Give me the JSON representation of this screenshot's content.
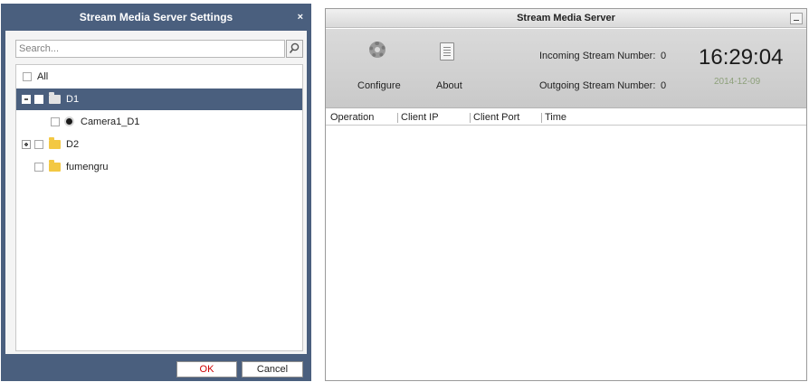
{
  "settings_dialog": {
    "title": "Stream Media Server Settings",
    "close_glyph": "×",
    "search_placeholder": "Search...",
    "tree": [
      {
        "label": "All",
        "level": 0
      },
      {
        "label": "D1",
        "level": 0,
        "selected": true,
        "expanded": true
      },
      {
        "label": "Camera1_D1",
        "level": 1
      },
      {
        "label": "D2",
        "level": 0,
        "expanded": false
      },
      {
        "label": "fumengru",
        "level": 0
      }
    ],
    "ok_label": "OK",
    "cancel_label": "Cancel"
  },
  "server_window": {
    "title": "Stream Media Server",
    "toolbar": {
      "configure_label": "Configure",
      "about_label": "About"
    },
    "stats": {
      "incoming_label": "Incoming Stream Number:",
      "incoming_value": "0",
      "outgoing_label": "Outgoing Stream Number:",
      "outgoing_value": "0"
    },
    "clock": {
      "time": "16:29:04",
      "date": "2014-12-09"
    },
    "table": {
      "columns": [
        "Operation",
        "Client IP",
        "Client Port",
        "Time"
      ]
    }
  },
  "colors": {
    "dialog_frame": "#4a5f7e",
    "ok_text": "#cc0000",
    "date_text": "#8da07a"
  }
}
